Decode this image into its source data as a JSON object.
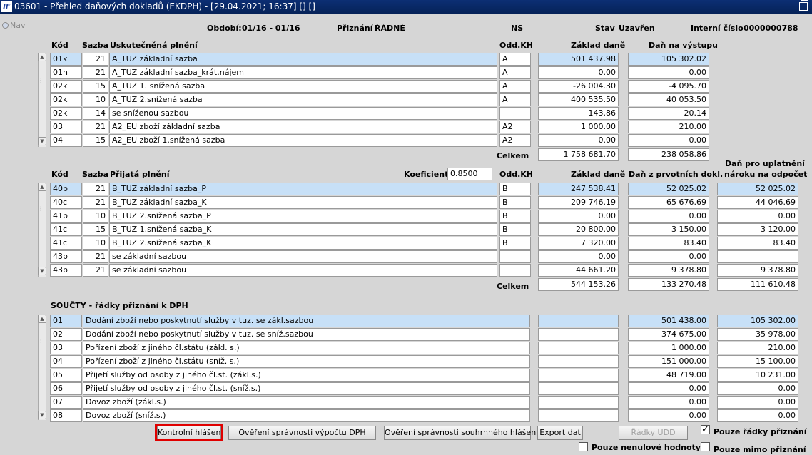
{
  "window": {
    "title": "03601 - Přehled daňových dokladů (EKDPH) - [29.04.2021; 16:37] [] []",
    "app_icon": "IF"
  },
  "nav": {
    "link": "Nav"
  },
  "header": {
    "obdobi_label": "Období:",
    "obdobi_value": "01/16 - 01/16",
    "priznani_label": "Přiznání",
    "priznani_value": "ŘÁDNÉ",
    "ns_label": "NS",
    "stav_label": "Stav",
    "stav_value": "Uzavřen",
    "interni_label": "Interní číslo",
    "interni_value": "0000000788"
  },
  "section1": {
    "col_kod": "Kód",
    "col_sazba": "Sazba",
    "col_name": "Uskutečněná plnění",
    "col_odd": "Odd.KH",
    "col_zaklad": "Základ daně",
    "col_dan": "Daň na výstupu",
    "rows": [
      {
        "kod": "01k",
        "sazba": "21",
        "name": "A_TUZ základní sazba",
        "odd": "A",
        "zaklad": "501 437.98",
        "dan": "105 302.02"
      },
      {
        "kod": "01n",
        "sazba": "21",
        "name": "A_TUZ základní sazba_krát.nájem",
        "odd": "A",
        "zaklad": "0.00",
        "dan": "0.00"
      },
      {
        "kod": "02k",
        "sazba": "15",
        "name": "A_TUZ 1. snížená sazba",
        "odd": "A",
        "zaklad": "-26 004.30",
        "dan": "-4 095.70"
      },
      {
        "kod": "02k",
        "sazba": "10",
        "name": "A_TUZ 2.snížená sazba",
        "odd": "A",
        "zaklad": "400 535.50",
        "dan": "40 053.50"
      },
      {
        "kod": "02k",
        "sazba": "14",
        "name": "se sníženou sazbou",
        "odd": "",
        "zaklad": "143.86",
        "dan": "20.14"
      },
      {
        "kod": "03",
        "sazba": "21",
        "name": "A2_EU zboží základní sazba",
        "odd": "A2",
        "zaklad": "1 000.00",
        "dan": "210.00"
      },
      {
        "kod": "04",
        "sazba": "15",
        "name": "A2_EU zboží 1.snížená sazba",
        "odd": "A2",
        "zaklad": "0.00",
        "dan": "0.00"
      }
    ],
    "celkem_label": "Celkem",
    "celkem_zaklad": "1 758 681.70",
    "celkem_dan": "238 058.86"
  },
  "section2": {
    "col_kod": "Kód",
    "col_sazba": "Sazba",
    "col_name": "Přijatá plnění",
    "koef_label": "Koeficient",
    "koef_value": "0.8500",
    "col_odd": "Odd.KH",
    "col_zaklad": "Základ daně",
    "col_dan": "Daň z prvotních dokl.",
    "col_odpocet_1": "Daň pro uplatnění",
    "col_odpocet_2": "nároku na odpočet",
    "rows": [
      {
        "kod": "40b",
        "sazba": "21",
        "name": "B_TUZ základní sazba_P",
        "odd": "B",
        "zaklad": "247 538.41",
        "dan": "52 025.02",
        "odpocet": "52 025.02"
      },
      {
        "kod": "40c",
        "sazba": "21",
        "name": "B_TUZ základní sazba_K",
        "odd": "B",
        "zaklad": "209 746.19",
        "dan": "65 676.69",
        "odpocet": "44 046.69"
      },
      {
        "kod": "41b",
        "sazba": "10",
        "name": "B_TUZ 2.snížená sazba_P",
        "odd": "B",
        "zaklad": "0.00",
        "dan": "0.00",
        "odpocet": "0.00"
      },
      {
        "kod": "41c",
        "sazba": "15",
        "name": "B_TUZ 1.snížená sazba_K",
        "odd": "B",
        "zaklad": "20 800.00",
        "dan": "3 150.00",
        "odpocet": "3 120.00"
      },
      {
        "kod": "41c",
        "sazba": "10",
        "name": "B_TUZ 2.snížená sazba_K",
        "odd": "B",
        "zaklad": "7 320.00",
        "dan": "83.40",
        "odpocet": "83.40"
      },
      {
        "kod": "43b",
        "sazba": "21",
        "name": "se základní sazbou",
        "odd": "",
        "zaklad": "0.00",
        "dan": "0.00",
        "odpocet": ""
      },
      {
        "kod": "43b",
        "sazba": "21",
        "name": "se základní sazbou",
        "odd": "",
        "zaklad": "44 661.20",
        "dan": "9 378.80",
        "odpocet": "9 378.80"
      }
    ],
    "celkem_label": "Celkem",
    "celkem_zaklad": "544 153.26",
    "celkem_dan": "133 270.48",
    "celkem_odpocet": "111 610.48"
  },
  "section3": {
    "title": "SOUČTY - řádky přiznání k DPH",
    "rows": [
      {
        "kod": "01",
        "name": "Dodání zboží nebo poskytnutí služby v tuz. se zákl.sazbou",
        "zaklad": "",
        "dan": "501 438.00",
        "odpocet": "105 302.00"
      },
      {
        "kod": "02",
        "name": "Dodání zboží nebo poskytnutí služby v tuz. se sníž.sazbou",
        "zaklad": "",
        "dan": "374 675.00",
        "odpocet": "35 978.00"
      },
      {
        "kod": "03",
        "name": "Pořízení zboží z jiného čl.státu (zákl. s.)",
        "zaklad": "",
        "dan": "1 000.00",
        "odpocet": "210.00"
      },
      {
        "kod": "04",
        "name": "Pořízení zboží z jiného čl.státu (sníž. s.)",
        "zaklad": "",
        "dan": "151 000.00",
        "odpocet": "15 100.00"
      },
      {
        "kod": "05",
        "name": "Přijetí služby od osoby z jiného čl.st. (zákl.s.)",
        "zaklad": "",
        "dan": "48 719.00",
        "odpocet": "10 231.00"
      },
      {
        "kod": "06",
        "name": "Přijetí služby od osoby z jiného čl.st. (sníž.s.)",
        "zaklad": "",
        "dan": "0.00",
        "odpocet": "0.00"
      },
      {
        "kod": "07",
        "name": "Dovoz zboží (zákl.s.)",
        "zaklad": "",
        "dan": "0.00",
        "odpocet": "0.00"
      },
      {
        "kod": "08",
        "name": "Dovoz zboží (sníž.s.)",
        "zaklad": "",
        "dan": "0.00",
        "odpocet": "0.00"
      }
    ]
  },
  "buttons": {
    "kontrolni": "Kontrolní hlášení",
    "overeni_dph": "Ověření správnosti výpočtu DPH",
    "overeni_souhrnne": "Ověření správnosti souhrnného hlášení",
    "export": "Export dat",
    "radky_udd": "Řádky UDD"
  },
  "checkboxes": {
    "pouze_radky": {
      "label": "Pouze řádky přiznání",
      "checked": true
    },
    "pouze_nenulove": {
      "label": "Pouze nenulové hodnoty",
      "checked": false
    },
    "pouze_mimo": {
      "label": "Pouze mimo přiznání",
      "checked": false
    }
  }
}
